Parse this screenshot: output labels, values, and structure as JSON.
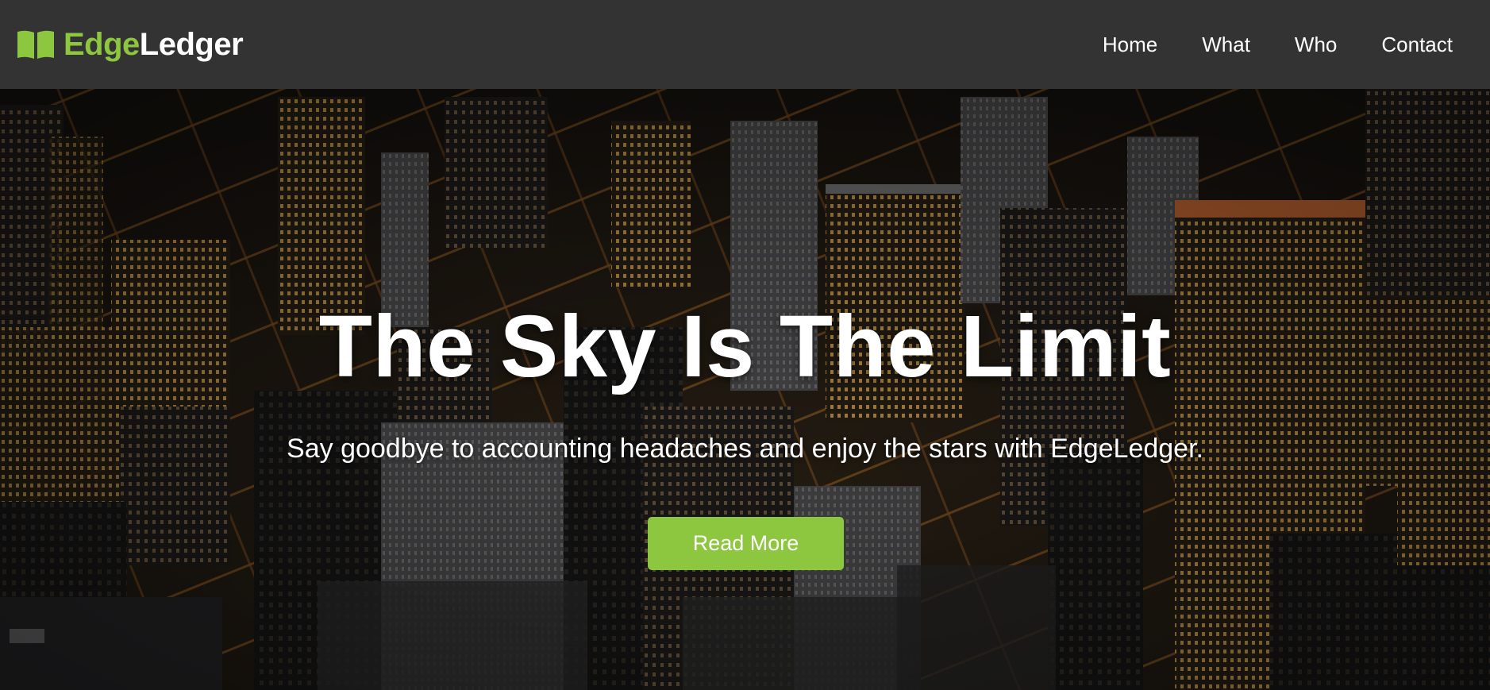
{
  "navbar": {
    "brand": {
      "part1": "Edge",
      "part2": "Ledger",
      "icon": "book-open-icon"
    },
    "links": [
      "Home",
      "What",
      "Who",
      "Contact"
    ]
  },
  "hero": {
    "title": "The Sky Is The Limit",
    "subtitle": "Say goodbye to accounting headaches and enjoy the stars with EdgeLedger.",
    "cta_label": "Read More",
    "background_image": "aerial-city-skyline-night"
  },
  "colors": {
    "accent": "#8dc63f",
    "navbar_bg": "#333333",
    "text": "#ffffff"
  }
}
